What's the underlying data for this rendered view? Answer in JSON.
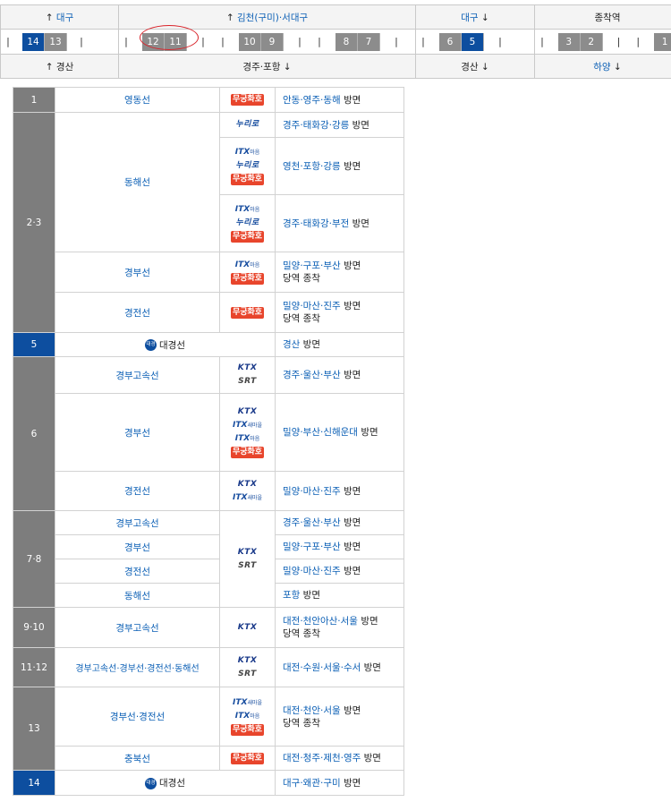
{
  "diagram": {
    "top": [
      {
        "arrow": "↑",
        "text": "대구"
      },
      {
        "arrow": "↑",
        "text": "김천(구미)·서대구"
      },
      {
        "text": "대구",
        "arrow": "↓"
      },
      {
        "text": "종착역"
      }
    ],
    "tracks": {
      "group1": [
        "14",
        "13"
      ],
      "group2": [
        "12",
        "11"
      ],
      "group3": [
        "10",
        "9"
      ],
      "group4": [
        "8",
        "7"
      ],
      "group5": [
        "6",
        "5"
      ],
      "group6": [
        "3",
        "2"
      ],
      "group7": [
        "1"
      ],
      "bar": "|"
    },
    "bottom": [
      {
        "arrow": "↑",
        "text": "경산"
      },
      {
        "text": "경주·포항",
        "arrow": "↓"
      },
      {
        "text": "경산",
        "arrow": "↓"
      },
      {
        "text": "하양",
        "arrow": "↓"
      }
    ]
  },
  "services": {
    "mugunghwa": "무궁화호",
    "nuriro": "누리로",
    "itx": "ITX",
    "itx_sub_maeum": "마음",
    "itx_sub_saemaeul": "새마을",
    "ktx": "KTX",
    "srt": "SRT",
    "daegyeong_icon": "대경"
  },
  "common": {
    "suffix": "방면",
    "terminate": "당역 종착"
  },
  "platforms": {
    "p1": {
      "no": "1",
      "line": "영동선",
      "dir": "안동·영주·동해"
    },
    "p23": {
      "no": "2·3",
      "line_r1": "동해선",
      "dir_r1": "경주·태화강·강릉",
      "dir_r2": "영천·포항·강릉",
      "dir_r3": "경주·태화강·부전",
      "line_r4": "경부선",
      "dir_r4": "밀양·구포·부산",
      "line_r5": "경전선",
      "dir_r5": "밀양·마산·진주"
    },
    "p5": {
      "no": "5",
      "line": "대경선",
      "dir": "경산"
    },
    "p6": {
      "no": "6",
      "line_r1": "경부고속선",
      "dir_r1": "경주·울산·부산",
      "line_r2": "경부선",
      "dir_r2": "밀양·부산·신해운대",
      "line_r3": "경전선",
      "dir_r3": "밀양·마산·진주"
    },
    "p78": {
      "no": "7·8",
      "line_r1": "경부고속선",
      "dir_r1": "경주·울산·부산",
      "line_r2": "경부선",
      "dir_r2": "밀양·구포·부산",
      "line_r3": "경전선",
      "dir_r3": "밀양·마산·진주",
      "line_r4": "동해선",
      "dir_r4": "포항"
    },
    "p910": {
      "no": "9·10",
      "line": "경부고속선",
      "dir": "대전·천안아산·서울"
    },
    "p1112": {
      "no": "11·12",
      "line": "경부고속선·경부선·경전선·동해선",
      "dir": "대전·수원·서울·수서"
    },
    "p13": {
      "no": "13",
      "line_r1": "경부선·경전선",
      "dir_r1": "대전·천안·서울",
      "line_r2": "충북선",
      "dir_r2": "대전·청주·제천·영주"
    },
    "p14": {
      "no": "14",
      "line": "대경선",
      "dir": "대구·왜관·구미"
    }
  }
}
